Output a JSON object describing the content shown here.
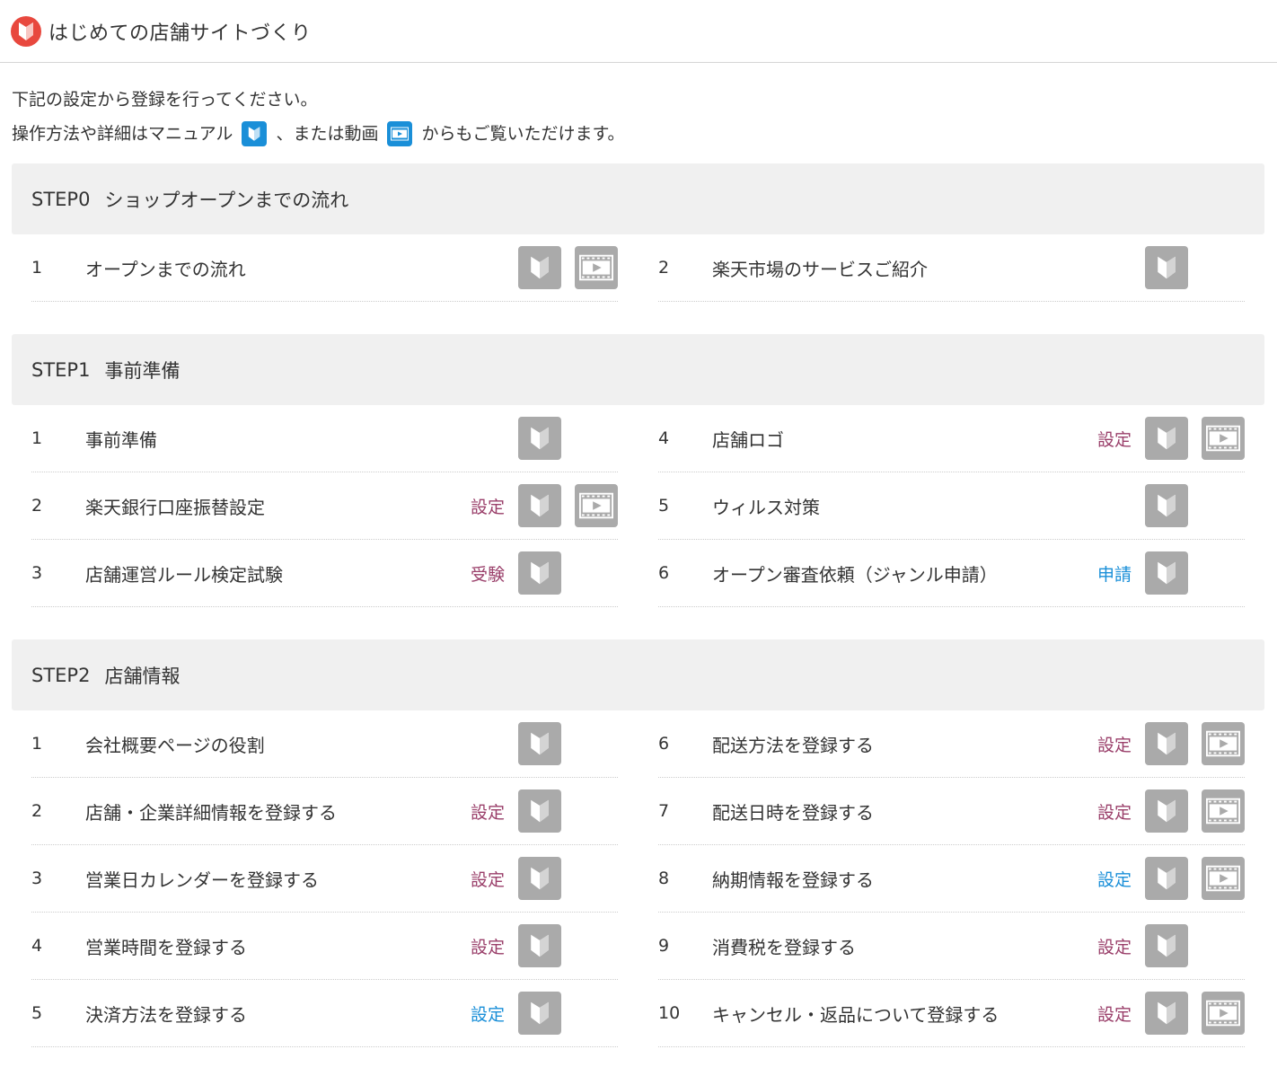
{
  "header": {
    "title": "はじめての店舗サイトづくり"
  },
  "intro": {
    "line1": "下記の設定から登録を行ってください。",
    "line2_a": "操作方法や詳細はマニュアル",
    "line2_b": "、または動画",
    "line2_c": "からもご覧いただけます。"
  },
  "colors": {
    "purple": "#9a3f6a",
    "blue": "#1a8fd8",
    "icon_gray": "#aaaaaa",
    "logo_red": "#e8483e"
  },
  "steps": [
    {
      "label": "STEP0",
      "title": "ショップオープンまでの流れ",
      "left": [
        {
          "num": "1",
          "title": "オープンまでの流れ",
          "action": "",
          "action_color": "",
          "manual": true,
          "video": true
        }
      ],
      "right": [
        {
          "num": "2",
          "title": "楽天市場のサービスご紹介",
          "action": "",
          "action_color": "",
          "manual": true,
          "video": false
        }
      ]
    },
    {
      "label": "STEP1",
      "title": "事前準備",
      "left": [
        {
          "num": "1",
          "title": "事前準備",
          "action": "",
          "action_color": "",
          "manual": true,
          "video": false
        },
        {
          "num": "2",
          "title": "楽天銀行口座振替設定",
          "action": "設定",
          "action_color": "purple",
          "manual": true,
          "video": true
        },
        {
          "num": "3",
          "title": "店舗運営ルール検定試験",
          "action": "受験",
          "action_color": "purple",
          "manual": true,
          "video": false
        }
      ],
      "right": [
        {
          "num": "4",
          "title": "店舗ロゴ",
          "action": "設定",
          "action_color": "purple",
          "manual": true,
          "video": true
        },
        {
          "num": "5",
          "title": "ウィルス対策",
          "action": "",
          "action_color": "",
          "manual": true,
          "video": false
        },
        {
          "num": "6",
          "title": "オープン審査依頼（ジャンル申請）",
          "action": "申請",
          "action_color": "blue",
          "manual": true,
          "video": false
        }
      ]
    },
    {
      "label": "STEP2",
      "title": "店舗情報",
      "left": [
        {
          "num": "1",
          "title": "会社概要ページの役割",
          "action": "",
          "action_color": "",
          "manual": true,
          "video": false
        },
        {
          "num": "2",
          "title": "店舗・企業詳細情報を登録する",
          "action": "設定",
          "action_color": "purple",
          "manual": true,
          "video": false
        },
        {
          "num": "3",
          "title": "営業日カレンダーを登録する",
          "action": "設定",
          "action_color": "purple",
          "manual": true,
          "video": false
        },
        {
          "num": "4",
          "title": "営業時間を登録する",
          "action": "設定",
          "action_color": "purple",
          "manual": true,
          "video": false
        },
        {
          "num": "5",
          "title": "決済方法を登録する",
          "action": "設定",
          "action_color": "blue",
          "manual": true,
          "video": false
        }
      ],
      "right": [
        {
          "num": "6",
          "title": "配送方法を登録する",
          "action": "設定",
          "action_color": "purple",
          "manual": true,
          "video": true
        },
        {
          "num": "7",
          "title": "配送日時を登録する",
          "action": "設定",
          "action_color": "purple",
          "manual": true,
          "video": true
        },
        {
          "num": "8",
          "title": "納期情報を登録する",
          "action": "設定",
          "action_color": "blue",
          "manual": true,
          "video": true
        },
        {
          "num": "9",
          "title": "消費税を登録する",
          "action": "設定",
          "action_color": "purple",
          "manual": true,
          "video": false
        },
        {
          "num": "10",
          "title": "キャンセル・返品について登録する",
          "action": "設定",
          "action_color": "purple",
          "manual": true,
          "video": true
        }
      ]
    }
  ]
}
